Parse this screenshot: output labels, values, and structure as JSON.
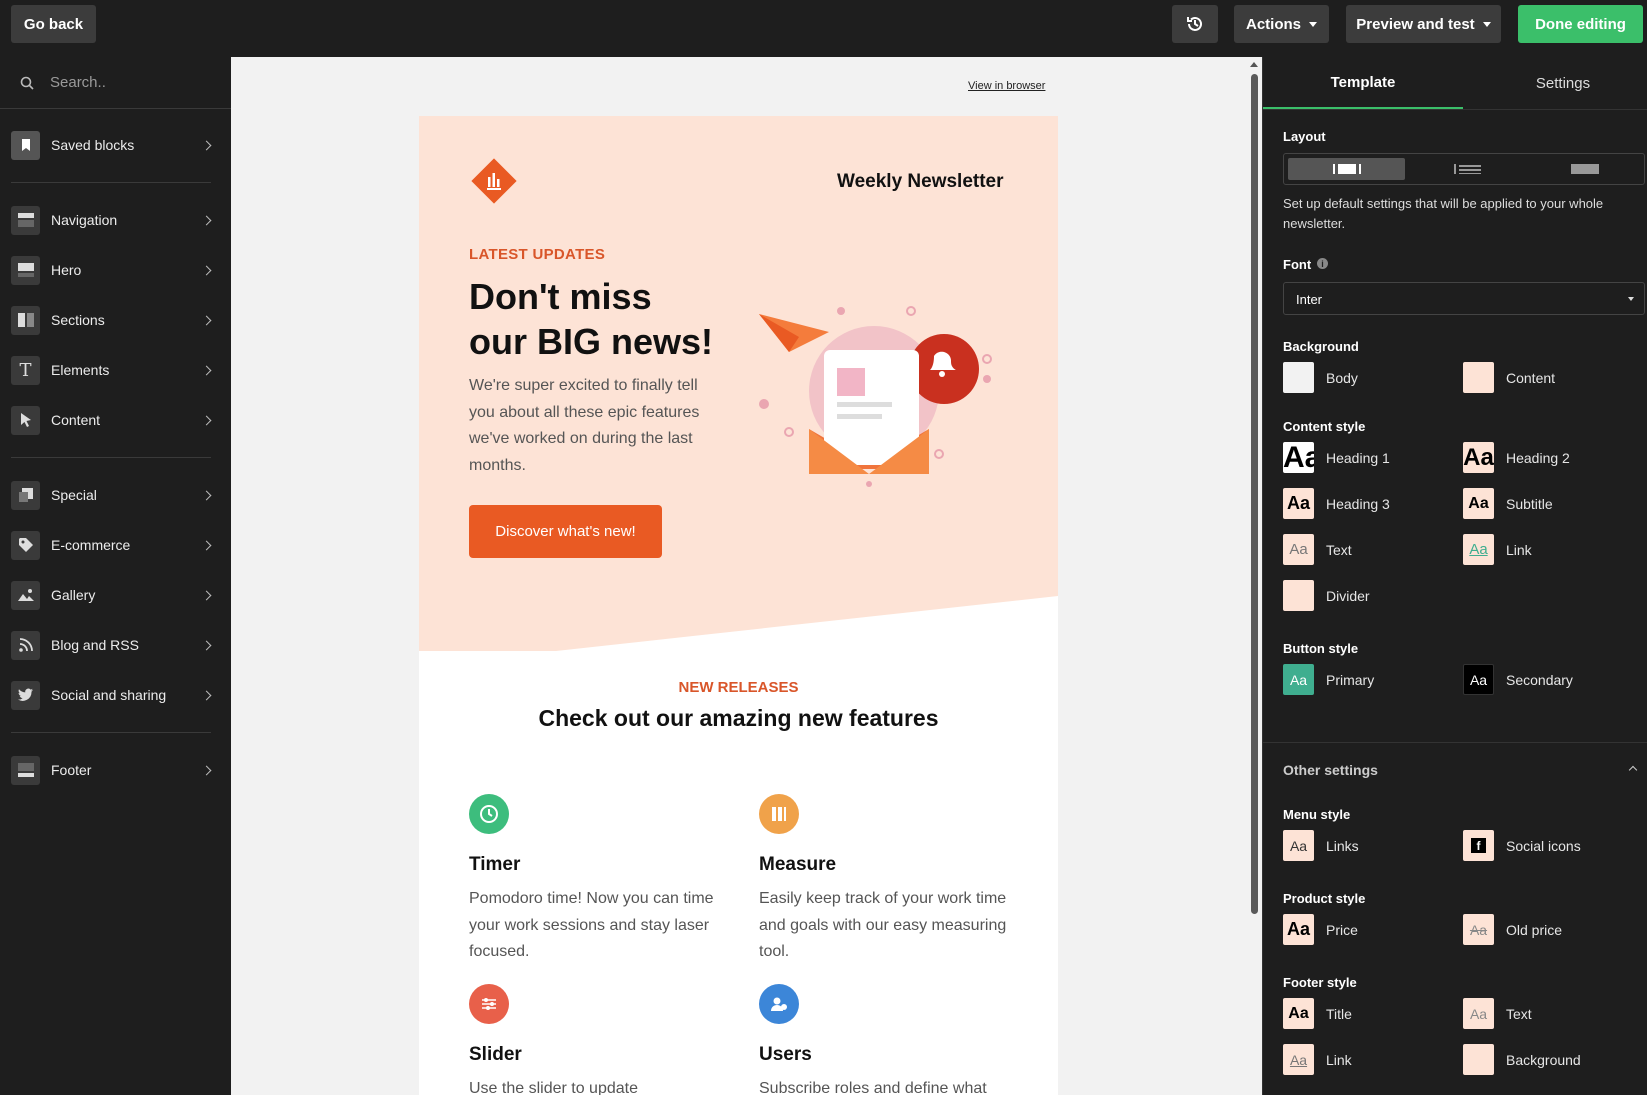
{
  "topbar": {
    "go_back": "Go back",
    "actions": "Actions",
    "preview": "Preview and test",
    "done": "Done editing"
  },
  "sidebar": {
    "search_placeholder": "Search..",
    "items": [
      {
        "label": "Saved blocks",
        "icon": "bookmark-icon"
      },
      {
        "label": "Navigation",
        "icon": "navigation-icon"
      },
      {
        "label": "Hero",
        "icon": "hero-icon"
      },
      {
        "label": "Sections",
        "icon": "sections-icon"
      },
      {
        "label": "Elements",
        "icon": "text-icon"
      },
      {
        "label": "Content",
        "icon": "cursor-icon"
      },
      {
        "label": "Special",
        "icon": "special-icon"
      },
      {
        "label": "E-commerce",
        "icon": "tag-icon"
      },
      {
        "label": "Gallery",
        "icon": "image-icon"
      },
      {
        "label": "Blog and RSS",
        "icon": "rss-icon"
      },
      {
        "label": "Social and sharing",
        "icon": "twitter-icon"
      },
      {
        "label": "Footer",
        "icon": "footer-icon"
      }
    ]
  },
  "email": {
    "view_in_browser": "View in browser",
    "newsletter_title": "Weekly Newsletter",
    "eyebrow": "LATEST UPDATES",
    "headline_line1": "Don't miss",
    "headline_line2": "our BIG news!",
    "intro": "We're super excited to finally tell you about all these epic features we've worked on during the last months.",
    "cta": "Discover what's new!",
    "section_eyebrow": "NEW RELEASES",
    "section_title": "Check out our amazing new features",
    "features": [
      {
        "title": "Timer",
        "text": "Pomodoro time! Now you can time your work sessions and stay laser focused.",
        "icon": "clock-icon",
        "color": "#3dbd7d"
      },
      {
        "title": "Measure",
        "text": "Easily keep track of your work time and goals with our easy measuring tool.",
        "icon": "measure-icon",
        "color": "#f0a24a"
      },
      {
        "title": "Slider",
        "text": "Use the slider to update",
        "icon": "slider-icon",
        "color": "#e8604a"
      },
      {
        "title": "Users",
        "text": "Subscribe roles and define what",
        "icon": "users-icon",
        "color": "#3c86d8"
      }
    ],
    "colors": {
      "hero_bg": "#fde3d6",
      "accent": "#e95a23"
    }
  },
  "panel": {
    "tabs": [
      "Template",
      "Settings"
    ],
    "layout_label": "Layout",
    "description": "Set up default settings that will be applied to your whole newsletter.",
    "font_label": "Font",
    "font_value": "Inter",
    "background_label": "Background",
    "background": [
      "Body",
      "Content"
    ],
    "content_style_label": "Content style",
    "content_style": [
      "Heading 1",
      "Heading 2",
      "Heading 3",
      "Subtitle",
      "Text",
      "Link",
      "Divider"
    ],
    "button_style_label": "Button style",
    "button_style": [
      "Primary",
      "Secondary"
    ],
    "other_settings": "Other settings",
    "menu_style_label": "Menu style",
    "menu_style": [
      "Links",
      "Social icons"
    ],
    "product_style_label": "Product style",
    "product_style": [
      "Price",
      "Old price"
    ],
    "footer_style_label": "Footer style",
    "footer_style": [
      "Title",
      "Text",
      "Link",
      "Background"
    ],
    "swatch_text": "Aa",
    "colors": {
      "primary": "#3fae8f",
      "secondary": "#000000",
      "content": "#fde3d6",
      "body": "#f2f2f2",
      "done": "#3bbf6a"
    }
  }
}
